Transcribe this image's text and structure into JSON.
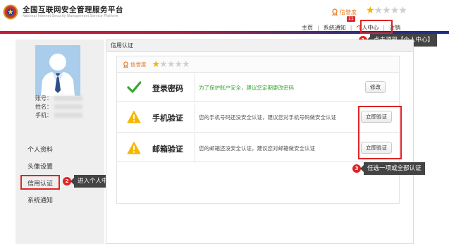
{
  "header": {
    "site_title": "全国互联网安全管理服务平台",
    "site_subtitle": "National Internet Security Management Service Platform",
    "credit_label": "信誉度",
    "credit_stars_filled": 1,
    "credit_stars_total": 5,
    "nav_badge": "11",
    "nav": [
      "主页",
      "系统通知",
      "个人中心",
      "注销"
    ]
  },
  "annotations": {
    "step1": {
      "number": "1",
      "text": "点击顶部【个人中心】"
    },
    "step2": {
      "number": "2",
      "text": "进入个人中心页面点击【信用认证】"
    },
    "step3": {
      "number": "3",
      "text": "任选一项或全部认证"
    }
  },
  "sidebar": {
    "account_label": "账号：",
    "name_label": "姓名：",
    "phone_label": "手机：",
    "menu": [
      "个人资料",
      "头像设置",
      "信用认证",
      "系统通知"
    ],
    "active_index": 2
  },
  "main": {
    "title": "信用认证",
    "credit_label": "信誉度",
    "credit_stars_filled": 1,
    "credit_stars_total": 5,
    "items": [
      {
        "name": "登录密码",
        "status": "ok",
        "icon": "check-icon",
        "desc": "为了保护账户安全，建议您定期更改密码",
        "button": "修改"
      },
      {
        "name": "手机验证",
        "status": "warn",
        "icon": "warning-icon",
        "desc": "您的手机号码还没安全认证，建议您对手机号码做安全认证",
        "button": "立即验证"
      },
      {
        "name": "邮箱验证",
        "status": "warn",
        "icon": "warning-icon",
        "desc": "您的邮箱还没安全认证，建议您对邮箱做安全认证",
        "button": "立即验证"
      }
    ]
  },
  "colors": {
    "accent_red": "#e02424",
    "credit_orange": "#e8731d",
    "star_gold": "#f3b300",
    "ok_green": "#3aa632",
    "warn_yellow": "#f5b800"
  }
}
